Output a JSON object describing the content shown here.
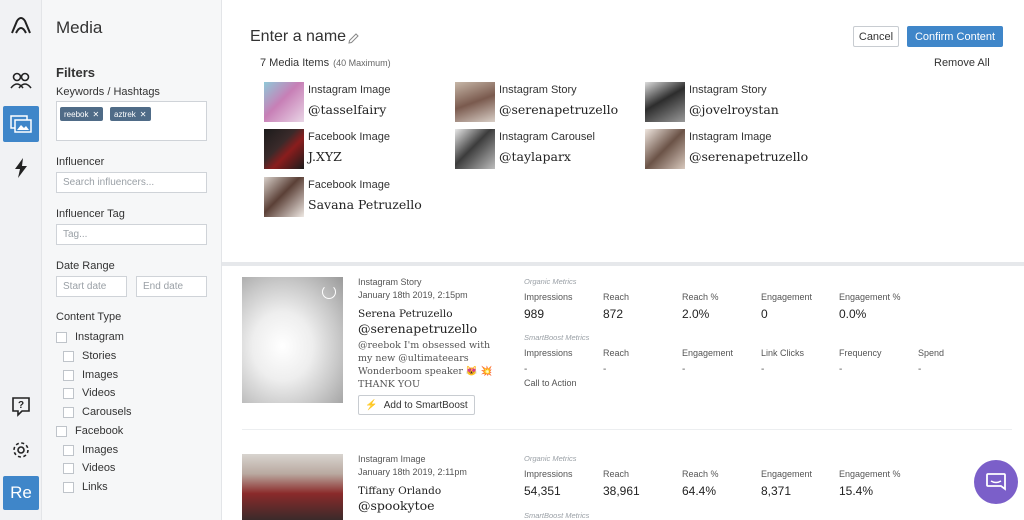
{
  "sidebar_title": "Media",
  "filters": {
    "heading": "Filters",
    "keywords_label": "Keywords / Hashtags",
    "keyword_chips": [
      "reebok",
      "aztrek"
    ],
    "chip_remove": "✕",
    "influencer_label": "Influencer",
    "influencer_placeholder": "Search influencers...",
    "influencer_tag_label": "Influencer Tag",
    "influencer_tag_placeholder": "Tag...",
    "date_range_label": "Date Range",
    "start_date_placeholder": "Start date",
    "end_date_placeholder": "End date",
    "content_type_label": "Content Type",
    "content_types": [
      {
        "label": "Instagram",
        "level": 0
      },
      {
        "label": "Stories",
        "level": 1
      },
      {
        "label": "Images",
        "level": 1
      },
      {
        "label": "Videos",
        "level": 1
      },
      {
        "label": "Carousels",
        "level": 1
      },
      {
        "label": "Facebook",
        "level": 0
      },
      {
        "label": "Images",
        "level": 1
      },
      {
        "label": "Videos",
        "level": 1
      },
      {
        "label": "Links",
        "level": 1
      }
    ]
  },
  "rail": {
    "icons": [
      "logo-icon",
      "influencers-icon",
      "media-icon",
      "boost-icon",
      "help-icon",
      "settings-icon"
    ],
    "badge": "Re",
    "accent": "#3f86c9"
  },
  "header": {
    "name_placeholder": "Enter a name",
    "cancel_label": "Cancel",
    "confirm_label": "Confirm Content",
    "count_label": "7 Media Items",
    "count_max": "(40 Maximum)",
    "remove_all_label": "Remove All"
  },
  "media_items": [
    {
      "kind": "Instagram Image",
      "handle": "@tasselfairy"
    },
    {
      "kind": "Instagram Story",
      "handle": "@serenapetruzello"
    },
    {
      "kind": "Instagram Story",
      "handle": "@jovelroystan"
    },
    {
      "kind": "Facebook Image",
      "handle": "J.XYZ"
    },
    {
      "kind": "Instagram Carousel",
      "handle": "@taylaparx"
    },
    {
      "kind": "Instagram Image",
      "handle": "@serenapetruzello"
    },
    {
      "kind": "Facebook Image",
      "handle": "Savana Petruzello"
    }
  ],
  "posts": [
    {
      "type": "Instagram Story",
      "date": "January 18th 2019, 2:15pm",
      "name": "Serena Petruzello",
      "handle": "@serenapetruzello",
      "caption": "@reebok I'm obsessed with my new @ultimateears Wonderboom speaker 😻 💥 THANK YOU",
      "boost_label": "Add to SmartBoost",
      "organic_label": "Organic Metrics",
      "organic": [
        {
          "label": "Impressions",
          "value": "989"
        },
        {
          "label": "Reach",
          "value": "872"
        },
        {
          "label": "Reach %",
          "value": "2.0%"
        },
        {
          "label": "Engagement",
          "value": "0"
        },
        {
          "label": "Engagement %",
          "value": "0.0%"
        }
      ],
      "smart_label": "SmartBoost Metrics",
      "smart": [
        {
          "label": "Impressions",
          "value": "-"
        },
        {
          "label": "Reach",
          "value": "-"
        },
        {
          "label": "Engagement",
          "value": "-"
        },
        {
          "label": "Link Clicks",
          "value": "-"
        },
        {
          "label": "Frequency",
          "value": "-"
        },
        {
          "label": "Spend",
          "value": "-"
        }
      ],
      "cta_label": "Call to Action"
    },
    {
      "type": "Instagram Image",
      "date": "January 18th 2019, 2:11pm",
      "name": "Tiffany Orlando",
      "handle": "@spookytoe",
      "organic_label": "Organic Metrics",
      "organic": [
        {
          "label": "Impressions",
          "value": "54,351"
        },
        {
          "label": "Reach",
          "value": "38,961"
        },
        {
          "label": "Reach %",
          "value": "64.4%"
        },
        {
          "label": "Engagement",
          "value": "8,371"
        },
        {
          "label": "Engagement %",
          "value": "15.4%"
        }
      ],
      "smart_label": "SmartBoost Metrics"
    }
  ],
  "chat_icon": "chat-icon",
  "colors": {
    "accent": "#3f86c9",
    "chip": "#4f6b87",
    "chat": "#7b5fc9"
  }
}
